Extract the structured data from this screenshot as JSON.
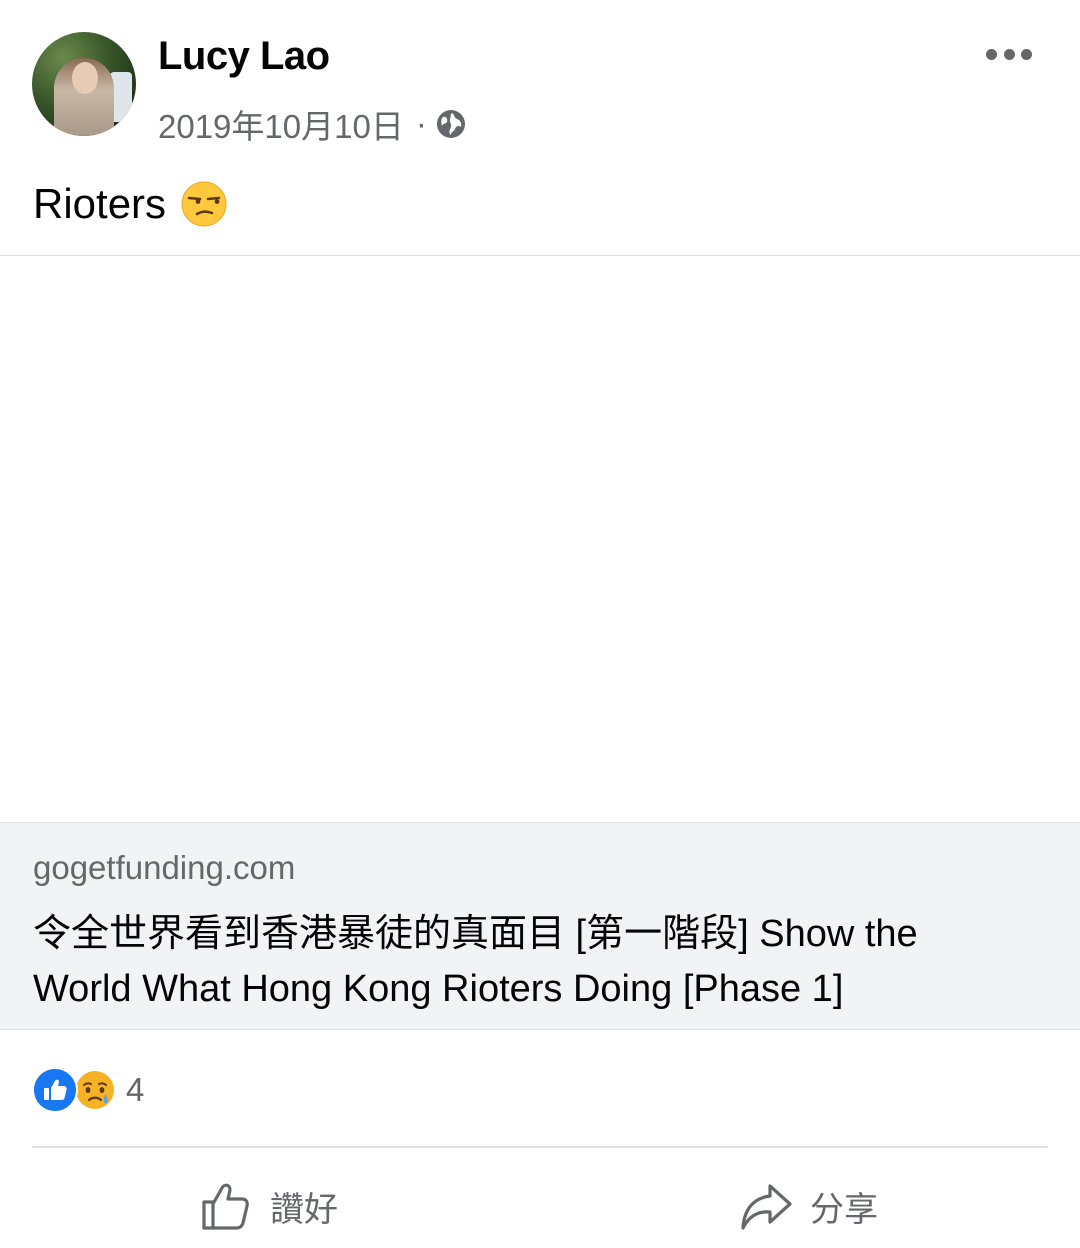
{
  "post": {
    "author": "Lucy Lao",
    "date": "2019年10月10日",
    "separator": "·",
    "privacy_icon": "globe-icon",
    "text": "Rioters",
    "text_emoji": "unamused-face-emoji"
  },
  "link_preview": {
    "domain": "gogetfunding.com",
    "title_line1": "令全世界看到香港暴徒的真面目 [第一階段] Show the",
    "title_line2": "World What Hong Kong Rioters Doing [Phase 1]"
  },
  "reactions": {
    "types": [
      "like",
      "sad"
    ],
    "count": "4"
  },
  "actions": {
    "like_label": "讚好",
    "share_label": "分享"
  },
  "colors": {
    "accent": "#1877f2",
    "secondary_text": "#65676b",
    "card_bg": "#f2f3f5"
  }
}
